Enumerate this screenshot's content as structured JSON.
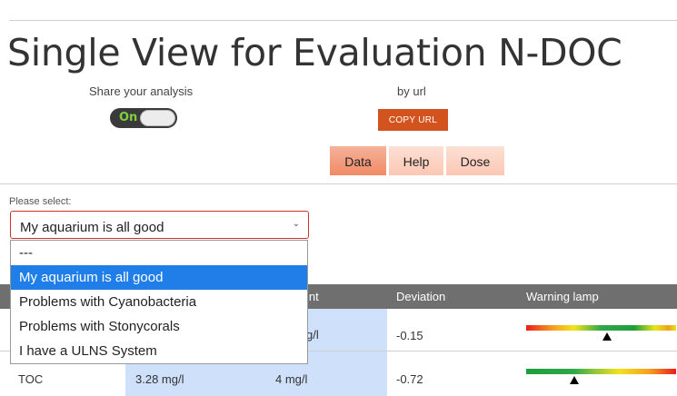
{
  "page_title": "Single View for Evaluation N-DOC",
  "share": {
    "label": "Share your analysis",
    "toggle_text": "On",
    "toggle_state": "on",
    "byurl_label": "by url",
    "copy_button": "COPY URL"
  },
  "tabs": [
    {
      "label": "Data",
      "active": true
    },
    {
      "label": "Help",
      "active": false
    },
    {
      "label": "Dose",
      "active": false
    }
  ],
  "select": {
    "prompt": "Please select:",
    "value": "My aquarium is all good",
    "options": [
      "---",
      "My aquarium is all good",
      "Problems with Cyanobacteria",
      "Problems with Stonycorals",
      "I have a ULNS System"
    ],
    "selected_index": 1
  },
  "table": {
    "headers": {
      "setpoint_fragment": "int",
      "deviation": "Deviation",
      "lamp": "Warning lamp"
    },
    "rows": [
      {
        "name": "",
        "value": "",
        "setpoint_fragment": "g/l",
        "deviation": "-0.15",
        "lamp_position": 0.54
      },
      {
        "name": "TOC",
        "value": "3.28 mg/l",
        "setpoint": "4 mg/l",
        "deviation": "-0.72",
        "lamp_position": 0.32
      }
    ]
  },
  "colors": {
    "accent": "#d3531f",
    "tab_active": "#f08a66",
    "tab_inactive": "#fbc7b4",
    "select_border": "#d32f2f",
    "option_highlight": "#1f7ee8",
    "table_header": "#6f6f6f",
    "setpoint_column": "#cfe0fb",
    "toggle_on_text": "#7fd13b"
  }
}
